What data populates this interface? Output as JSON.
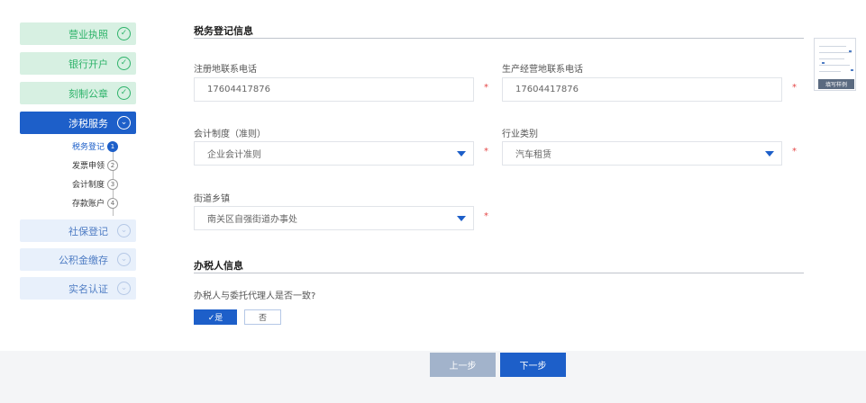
{
  "sidebar": {
    "steps": [
      {
        "label": "营业执照",
        "status": "done",
        "icon": "check-circle-icon"
      },
      {
        "label": "银行开户",
        "status": "done",
        "icon": "check-circle-icon"
      },
      {
        "label": "刻制公章",
        "status": "done",
        "icon": "check-circle-icon"
      },
      {
        "label": "涉税服务",
        "status": "active",
        "icon": "chevron-down-circle-icon"
      },
      {
        "label": "社保登记",
        "status": "pending",
        "icon": "chevron-down-circle-icon"
      },
      {
        "label": "公积金缴存",
        "status": "pending",
        "icon": "chevron-down-circle-icon"
      },
      {
        "label": "实名认证",
        "status": "pending",
        "icon": "chevron-down-circle-icon"
      }
    ],
    "substeps": [
      {
        "label": "税务登记",
        "num": "1",
        "current": true
      },
      {
        "label": "发票申领",
        "num": "2",
        "current": false
      },
      {
        "label": "会计制度",
        "num": "3",
        "current": false
      },
      {
        "label": "存款账户",
        "num": "4",
        "current": false
      }
    ]
  },
  "tax_section": {
    "title": "税务登记信息",
    "reg_phone": {
      "label": "注册地联系电话",
      "value": "17604417876"
    },
    "biz_phone": {
      "label": "生产经营地联系电话",
      "value": "17604417876"
    },
    "accounting": {
      "label": "会计制度（准则）",
      "value": "企业会计准则"
    },
    "industry": {
      "label": "行业类别",
      "value": "汽车租赁"
    },
    "street": {
      "label": "街道乡镇",
      "value": "南关区自强街道办事处"
    },
    "required_mark": "*"
  },
  "agent_section": {
    "title": "办税人信息",
    "question": "办税人与委托代理人是否一致?",
    "yes_label": "✓是",
    "no_label": "否"
  },
  "sample": {
    "label": "填写样例"
  },
  "nav": {
    "prev_label": "上一步",
    "next_label": "下一步"
  },
  "colors": {
    "primary": "#1d5fc9",
    "done_green": "#2eb36a",
    "required_red": "#e54848"
  }
}
